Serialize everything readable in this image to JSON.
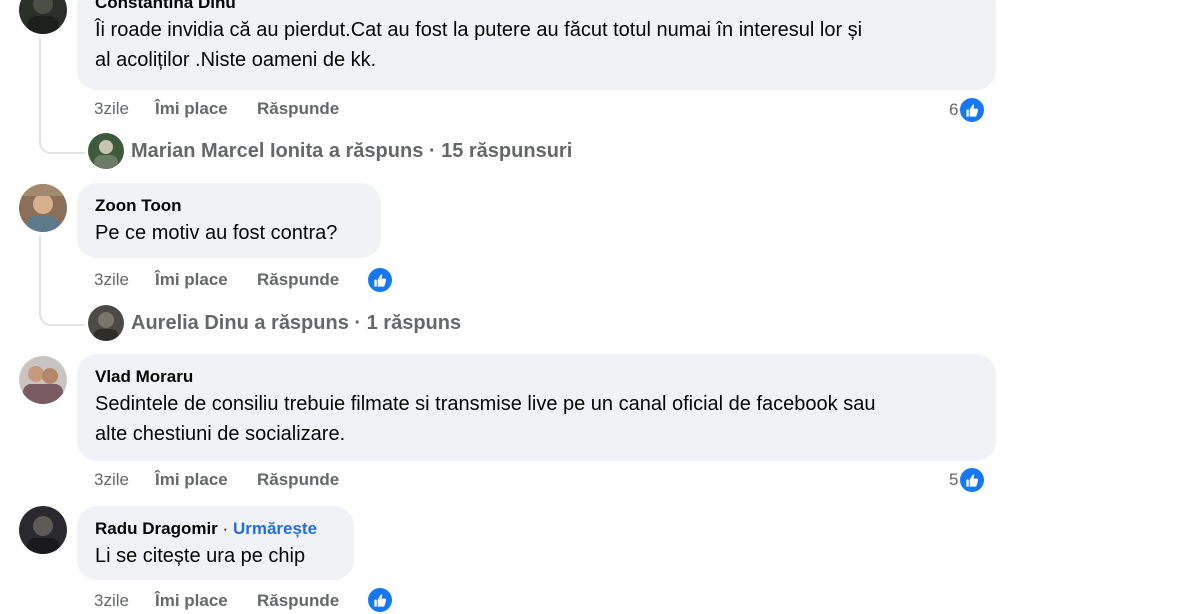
{
  "comments": [
    {
      "author": "Constantina Dinu",
      "text_lines": [
        "Îi roade invidia că au pierdut.Cat au fost la putere au făcut totul numai în interesul lor și",
        "al acoliților .Niste oameni de kk."
      ],
      "time": "3zile",
      "like_label": "Îmi place",
      "reply_label": "Răspunde",
      "reaction_count": "6",
      "replies_summary": "Marian Marcel Ionita a răspuns · 15 răspunsuri"
    },
    {
      "author": "Zoon Toon",
      "text_lines": [
        "Pe ce motiv au fost contra?"
      ],
      "time": "3zile",
      "like_label": "Îmi place",
      "reply_label": "Răspunde",
      "reaction_count": "",
      "replies_summary": "Aurelia Dinu a răspuns · 1 răspuns"
    },
    {
      "author": "Vlad Moraru",
      "text_lines": [
        "Sedintele de consiliu trebuie filmate si transmise live pe un canal oficial de facebook sau",
        "alte chestiuni de socializare."
      ],
      "time": "3zile",
      "like_label": "Îmi place",
      "reply_label": "Răspunde",
      "reaction_count": "5"
    },
    {
      "author": "Radu Dragomir",
      "separator": "·",
      "follow_label": "Urmărește",
      "text_lines": [
        "Li se citește ura pe chip"
      ],
      "time": "3zile",
      "like_label": "Îmi place",
      "reply_label": "Răspunde",
      "reaction_count": ""
    }
  ],
  "icons": {
    "reaction": "like-thumb-icon"
  },
  "colors": {
    "accent": "#1877f2",
    "bubble": "#f0f2f5",
    "muted_text": "#65676b",
    "follow_link": "#216fdb"
  }
}
